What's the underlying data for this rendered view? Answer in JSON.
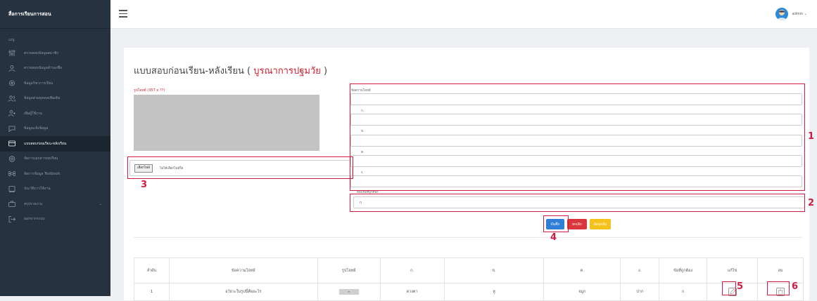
{
  "sidebar": {
    "brand": "สื่อการเรียนการสอน",
    "section_caption": "เมนู",
    "items": [
      {
        "label": "ตรวจสอบข้อมูลสมาชิก",
        "icon": "sliders-icon"
      },
      {
        "label": "ตรวจสอบข้อมูลสำรองชื่อ",
        "icon": "user-icon"
      },
      {
        "label": "ข้อมูลวิชาการเรียน",
        "icon": "gear-icon"
      },
      {
        "label": "ข้อมูลส่วนบุคคลเพิ่มเติม",
        "icon": "users-icon"
      },
      {
        "label": "เพิ่มผู้ใช้งาน",
        "icon": "user-plus-icon"
      },
      {
        "label": "ข้อมูลเเจ้งข้อมูล",
        "icon": "chat-icon"
      },
      {
        "label": "แบบสอบก่อนเรียน-หลังเรียน",
        "icon": "card-icon",
        "active": true
      },
      {
        "label": "จัดการเอกสารบทเรียน",
        "icon": "settings-icon"
      },
      {
        "label": "จัดการข้อมูล Textbook",
        "icon": "command-icon"
      },
      {
        "label": "ประวัติการใช้งาน",
        "icon": "square-icon"
      },
      {
        "label": "สรุปรายงาน",
        "icon": "briefcase-icon",
        "chevron": "⌄"
      },
      {
        "label": "ออกจากระบบ",
        "icon": "logout-icon"
      }
    ]
  },
  "topbar": {
    "user": "admin ⌄"
  },
  "page": {
    "title_prefix": "แบบสอบก่อนเรียน-หลังเรียน ( ",
    "title_highlight": "บูรณาการปฐมวัย",
    "title_suffix": " )",
    "image_label": "รูปโจทย์ (357 x ??)",
    "file_button": "เลือกไฟล์",
    "file_none": "ไม่ได้เลือกไฟล์ใด",
    "question_label": "ข้อความโจทย์",
    "choice_a_label": "ก.",
    "choice_b_label": "ข.",
    "choice_c_label": "ค.",
    "choice_d_label": "ง.",
    "answer_label": "ตอบข้อที่ถูกต้อง",
    "answer_value": "ก",
    "buttons": {
      "save": "บันทึก",
      "cancel": "ยกเลิก",
      "back": "ย้อนกลับ"
    }
  },
  "table": {
    "headers": [
      "ลำดับ",
      "ข้อความโจทย์",
      "รูปโจทย์",
      "ก.",
      "ข.",
      "ค.",
      "ง.",
      "ข้อที่ถูกต้อง",
      "แก้ไข",
      "ลบ"
    ],
    "rows": [
      {
        "no": "1",
        "question": "อวัยวะในรูปนี้คืออะไร",
        "image": "≡",
        "a": "ดวงตา",
        "b": "หู",
        "c": "จมูก",
        "d": "ปาก",
        "answer": "ก"
      }
    ]
  },
  "annotations": [
    "1",
    "2",
    "3",
    "4",
    "5",
    "6"
  ],
  "colors": {
    "accent": "#d01c40",
    "sidebar": "#263240",
    "save": "#2f7fd6",
    "cancel": "#d9373c",
    "back": "#f5c21b"
  }
}
